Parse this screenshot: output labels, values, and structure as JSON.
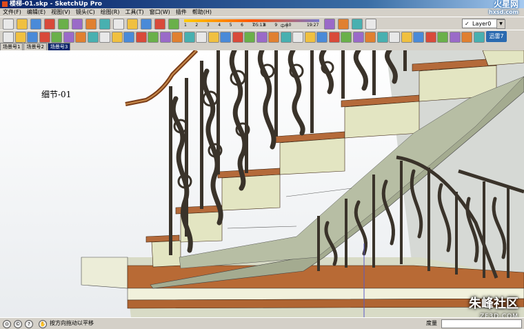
{
  "window": {
    "title": "楼梯-01.skp - SketchUp Pro"
  },
  "menu": [
    "文件(F)",
    "编辑(E)",
    "视图(V)",
    "镜头(C)",
    "绘图(R)",
    "工具(T)",
    "窗口(W)",
    "插件",
    "帮助(H)"
  ],
  "logo": {
    "text": "火星网",
    "sub": "hxsd.com"
  },
  "toolbar": {
    "layer_selected": "Layer0",
    "shadow_months": [
      "1",
      "2",
      "3",
      "4",
      "5",
      "6",
      "7",
      "8",
      "9",
      "10",
      "11",
      "12"
    ],
    "shadow_time": "05:13",
    "shadow_noon": "中午",
    "shadow_end": "19:27",
    "popup": "迅雷7"
  },
  "scenes": {
    "tabs": [
      "场景号1",
      "场景号2",
      "场景号3"
    ],
    "active": 2
  },
  "viewport": {
    "label": "细节-01"
  },
  "status": {
    "hint": "按方向拖动以平移",
    "measure_label": "度量",
    "measure_value": ""
  },
  "watermark": {
    "text": "朱峰社区",
    "sub": "ZF3D.COM"
  },
  "colors": {
    "titlebar": "#0a246a",
    "railing": "#3a332a",
    "tread": "#b46a3a",
    "riser": "#e3e5c2",
    "stringer": "#a4ab90"
  },
  "icons": [
    "new-icon",
    "open-icon",
    "save-icon",
    "cut-icon",
    "copy-icon",
    "paste-icon",
    "erase-icon",
    "undo-icon",
    "redo-icon",
    "print-icon",
    "model-info-icon",
    "select-icon",
    "component-icon",
    "paint-icon",
    "eraser-icon",
    "rectangle-icon",
    "line-icon",
    "circle-icon",
    "arc-icon",
    "polygon-icon",
    "freehand-icon",
    "move-icon",
    "push-pull-icon",
    "rotate-icon",
    "follow-me-icon",
    "scale-icon",
    "offset-icon",
    "tape-icon",
    "dimension-icon",
    "protractor-icon",
    "text-icon",
    "axes-icon",
    "3d-text-icon",
    "orbit-icon",
    "pan-icon",
    "zoom-icon",
    "zoom-window-icon",
    "zoom-extents-icon",
    "previous-view-icon",
    "next-view-icon",
    "position-camera-icon",
    "walk-icon",
    "look-around-icon",
    "section-plane-icon",
    "iso-view-icon",
    "top-view-icon",
    "front-view-icon",
    "right-view-icon",
    "back-view-icon",
    "left-view-icon",
    "xray-icon",
    "wireframe-icon",
    "hidden-line-icon",
    "shaded-icon",
    "textured-icon",
    "monochrome-icon",
    "layer-icon"
  ]
}
